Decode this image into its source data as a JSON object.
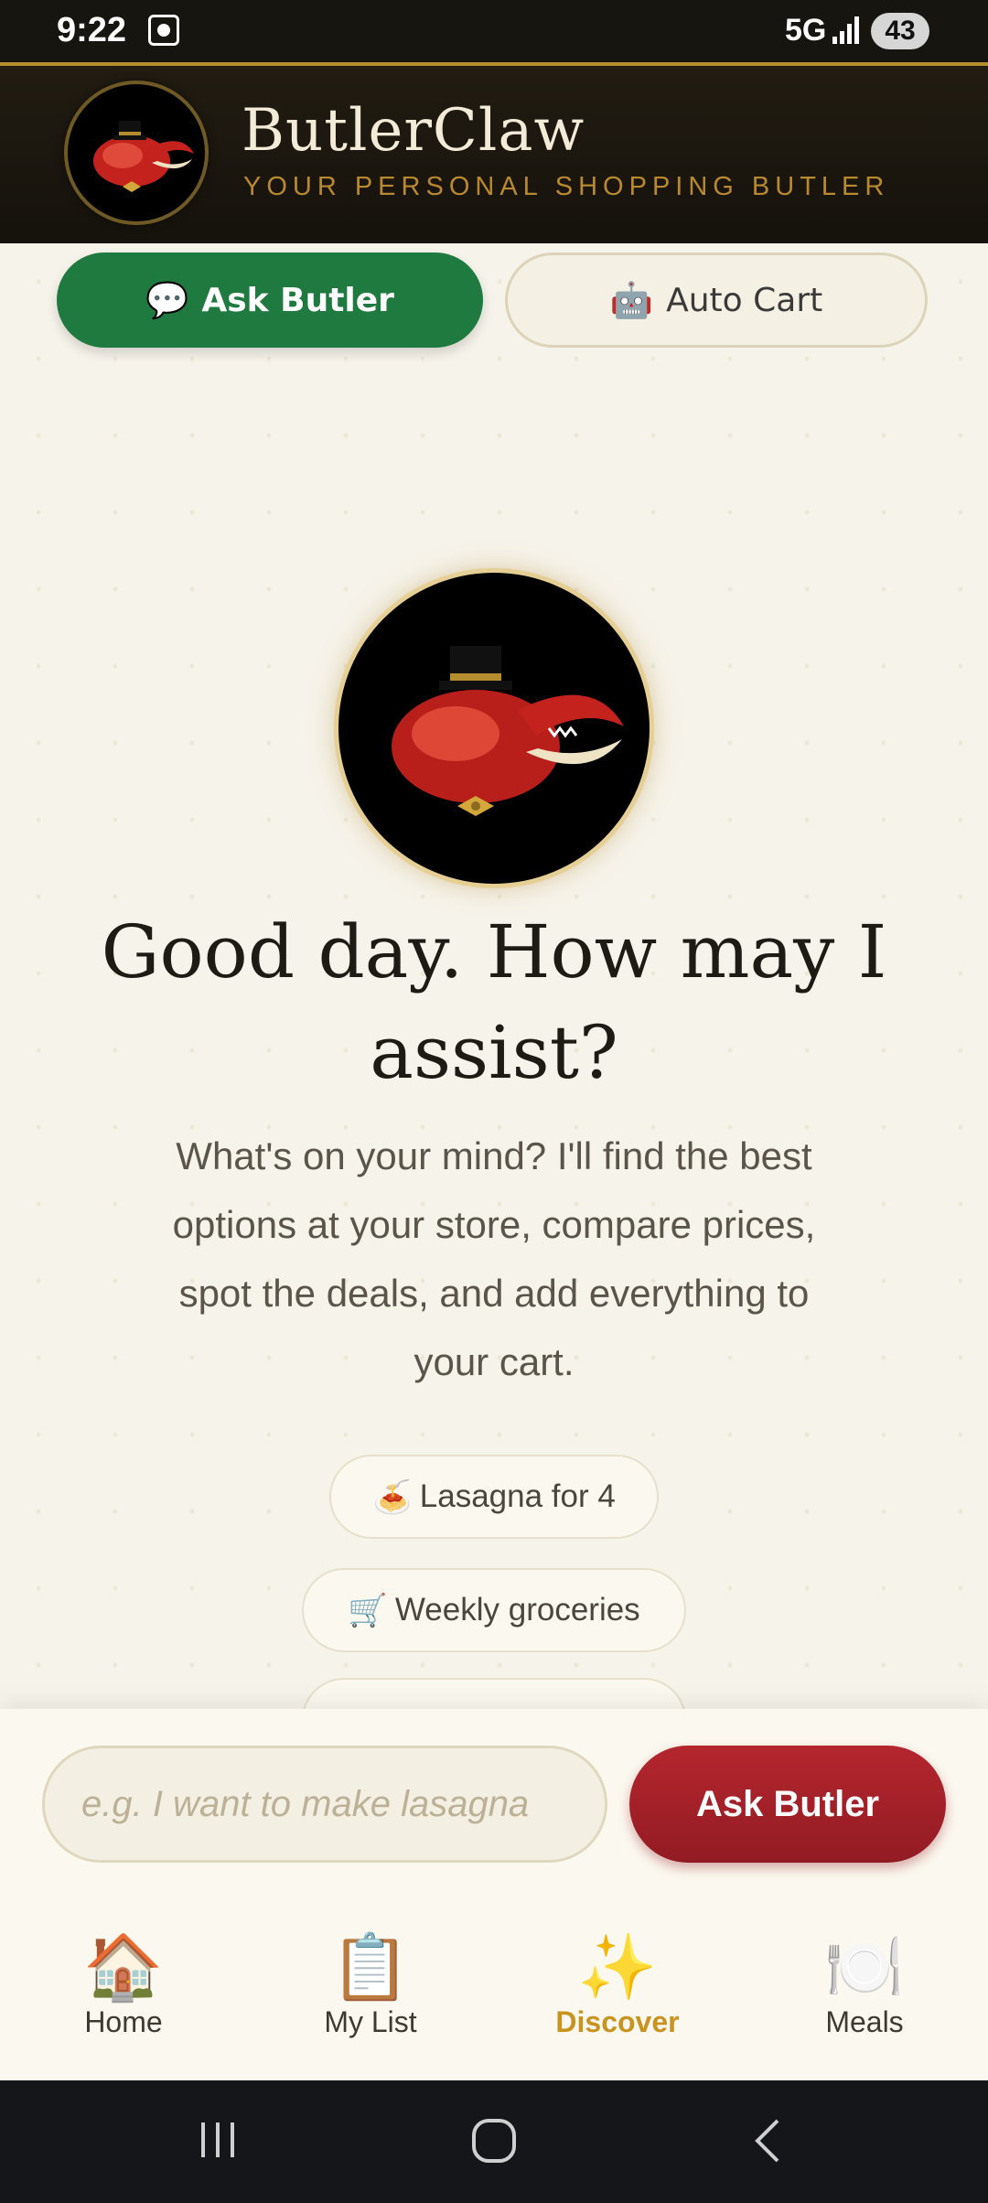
{
  "status": {
    "time": "9:22",
    "network": "5G",
    "battery": "43"
  },
  "header": {
    "brand": "ButlerClaw",
    "tagline": "YOUR PERSONAL SHOPPING BUTLER"
  },
  "tabs": {
    "ask": {
      "icon": "💬",
      "label": "Ask Butler"
    },
    "auto": {
      "icon": "🤖",
      "label": "Auto Cart"
    }
  },
  "hero": {
    "greeting": "Good day. How may I assist?",
    "intro": "What's on your mind? I'll find the best options at your store, compare prices, spot the deals, and add everything to your cart."
  },
  "suggestions": [
    {
      "icon": "🍝",
      "label": "Lasagna for 4"
    },
    {
      "icon": "🛒",
      "label": "Weekly groceries"
    }
  ],
  "composer": {
    "placeholder": "e.g. I want to make lasagna",
    "button": "Ask Butler"
  },
  "nav": [
    {
      "icon": "🏠",
      "label": "Home"
    },
    {
      "icon": "📋",
      "label": "My List"
    },
    {
      "icon": "✨",
      "label": "Discover"
    },
    {
      "icon": "🍽️",
      "label": "Meals"
    }
  ],
  "colors": {
    "accent_green": "#1f7a3f",
    "accent_red": "#a82129",
    "gold": "#c99320",
    "header_bg": "#1a160f"
  }
}
